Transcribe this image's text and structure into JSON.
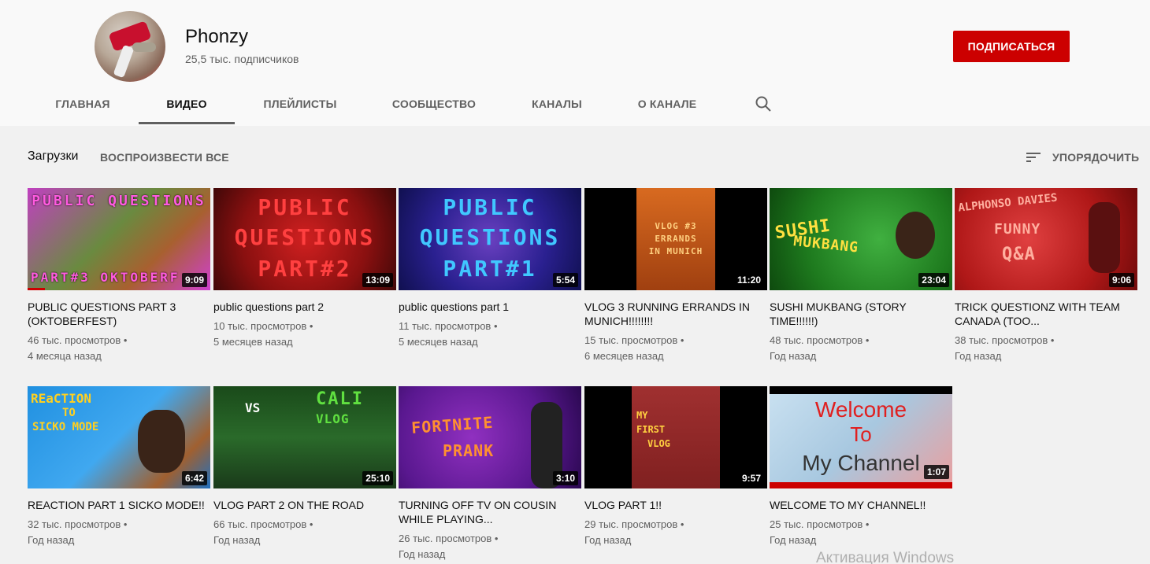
{
  "channel": {
    "name": "Phonzy",
    "subscribers": "25,5 тыс. подписчиков",
    "subscribe_label": "ПОДПИСАТЬСЯ"
  },
  "tabs": [
    {
      "label": "ГЛАВНАЯ"
    },
    {
      "label": "ВИДЕО"
    },
    {
      "label": "ПЛЕЙЛИСТЫ"
    },
    {
      "label": "СООБЩЕСТВО"
    },
    {
      "label": "КАНАЛЫ"
    },
    {
      "label": "О КАНАЛЕ"
    }
  ],
  "active_tab": "ВИДЕО",
  "shelf": {
    "title": "Загрузки",
    "play_all": "ВОСПРОИЗВЕСТИ ВСЕ",
    "sort_label": "УПОРЯДОЧИТЬ"
  },
  "videos": [
    {
      "title": "PUBLIC QUESTIONS PART 3 (OKTOBERFEST)",
      "views": "46 тыс. просмотров",
      "date": "4 месяца назад",
      "duration": "9:09",
      "thumb_text": "PUBLIC QUESTIONS",
      "thumb_text2": "PART#3 OKTOBERF"
    },
    {
      "title": "public questions part 2",
      "views": "10 тыс. просмотров",
      "date": "5 месяцев назад",
      "duration": "13:09",
      "thumb_text": "PUBLIC",
      "thumb_text2": "QUESTIONS",
      "thumb_text3": "PART#2"
    },
    {
      "title": "public questions part 1",
      "views": "11 тыс. просмотров",
      "date": "5 месяцев назад",
      "duration": "5:54",
      "thumb_text": "PUBLIC",
      "thumb_text2": "QUESTIONS",
      "thumb_text3": "PART#1"
    },
    {
      "title": "VLOG 3 RUNNING ERRANDS IN MUNICH!!!!!!!!",
      "views": "15 тыс. просмотров",
      "date": "6 месяцев назад",
      "duration": "11:20",
      "thumb_text": "VLOG #3",
      "thumb_text2": "ERRANDS",
      "thumb_text3": "IN MUNICH"
    },
    {
      "title": "SUSHI MUKBANG (STORY TIME!!!!!!)",
      "views": "48 тыс. просмотров",
      "date": "Год назад",
      "duration": "23:04",
      "thumb_text": "SUSHI",
      "thumb_text2": "MUKBANG"
    },
    {
      "title": "TRICK QUESTIONZ WITH TEAM CANADA (TOO...",
      "views": "38 тыс. просмотров",
      "date": "Год назад",
      "duration": "9:06",
      "thumb_text": "ALPHONSO DAVIES",
      "thumb_text2": "FUNNY",
      "thumb_text3": "Q&A"
    },
    {
      "title": "REACTION PART 1 SICKO MODE!!",
      "views": "32 тыс. просмотров",
      "date": "Год назад",
      "duration": "6:42",
      "thumb_text": "REaCTION",
      "thumb_text2": "TO",
      "thumb_text3": "SICKO MODE"
    },
    {
      "title": "VLOG PART 2 ON THE ROAD",
      "views": "66 тыс. просмотров",
      "date": "Год назад",
      "duration": "25:10",
      "thumb_text": "VS",
      "thumb_text2": "CALI",
      "thumb_text3": "VLOG"
    },
    {
      "title": "TURNING OFF TV ON COUSIN WHILE PLAYING...",
      "views": "26 тыс. просмотров",
      "date": "Год назад",
      "duration": "3:10",
      "thumb_text": "FORTNITE",
      "thumb_text2": "PRANK"
    },
    {
      "title": "VLOG PART 1!!",
      "views": "29 тыс. просмотров",
      "date": "Год назад",
      "duration": "9:57",
      "thumb_text": "MY",
      "thumb_text2": "FIRST",
      "thumb_text3": "VLOG"
    },
    {
      "title": "WELCOME TO MY CHANNEL!!",
      "views": "25 тыс. просмотров",
      "date": "Год назад",
      "duration": "1:07",
      "thumb_text": "Welcome",
      "thumb_text2": "To",
      "thumb_text3": "My Channel"
    }
  ],
  "meta_separator": "•",
  "watermark": "Активация Windows",
  "colors": {
    "brand_red": "#cc0000",
    "text_secondary": "#606060"
  }
}
